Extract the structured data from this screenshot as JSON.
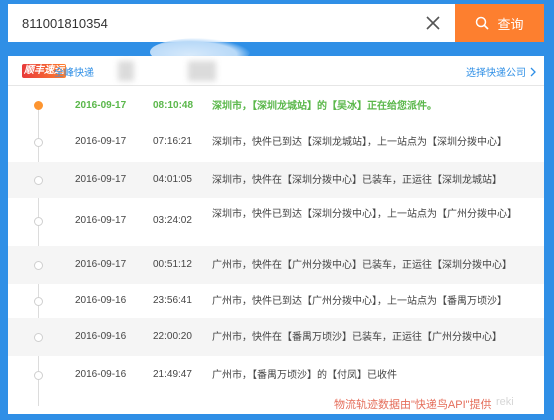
{
  "search": {
    "value": "811001810354",
    "query_label": "查询"
  },
  "provider": {
    "logo_text": "顺丰速运",
    "name": "全峰快递",
    "select_label": "选择快递公司"
  },
  "timeline": {
    "entries": [
      {
        "date": "2016-09-17",
        "time": "08:10:48",
        "text": "深圳市，【深圳龙城站】的【吴冰】正在给您派件。"
      },
      {
        "date": "2016-09-17",
        "time": "07:16:21",
        "text": "深圳市，快件已到达【深圳龙城站】，上一站点为【深圳分拨中心】"
      },
      {
        "date": "2016-09-17",
        "time": "04:01:05",
        "text": "深圳市，快件在【深圳分拨中心】已装车，正运往【深圳龙城站】"
      },
      {
        "date": "2016-09-17",
        "time": "03:24:02",
        "text": "深圳市，快件已到达【深圳分拨中心】，上一站点为【广州分拨中心】"
      },
      {
        "date": "2016-09-17",
        "time": "00:51:12",
        "text": "广州市，快件在【广州分拨中心】已装车，正运往【深圳分拨中心】"
      },
      {
        "date": "2016-09-16",
        "time": "23:56:41",
        "text": "广州市，快件已到达【广州分拨中心】，上一站点为【番禺万顷沙】"
      },
      {
        "date": "2016-09-16",
        "time": "22:00:20",
        "text": "广州市，快件在【番禺万顷沙】已装车，正运往【广州分拨中心】"
      },
      {
        "date": "2016-09-16",
        "time": "21:49:47",
        "text": "广州市，【番禺万顷沙】的【付凤】已收件"
      }
    ]
  },
  "watermark": {
    "text": "物流轨迹数据由\"快递鸟API\"提供",
    "trail": "reki"
  },
  "colors": {
    "background": "#2f8fe6",
    "query_button": "#fd7f2f",
    "latest_text": "#5ab74a",
    "active_dot": "#fd9531",
    "watermark": "#e0533d"
  },
  "icons": {
    "clear": "close-icon",
    "query": "search-icon",
    "select": "chevron-right-icon"
  }
}
